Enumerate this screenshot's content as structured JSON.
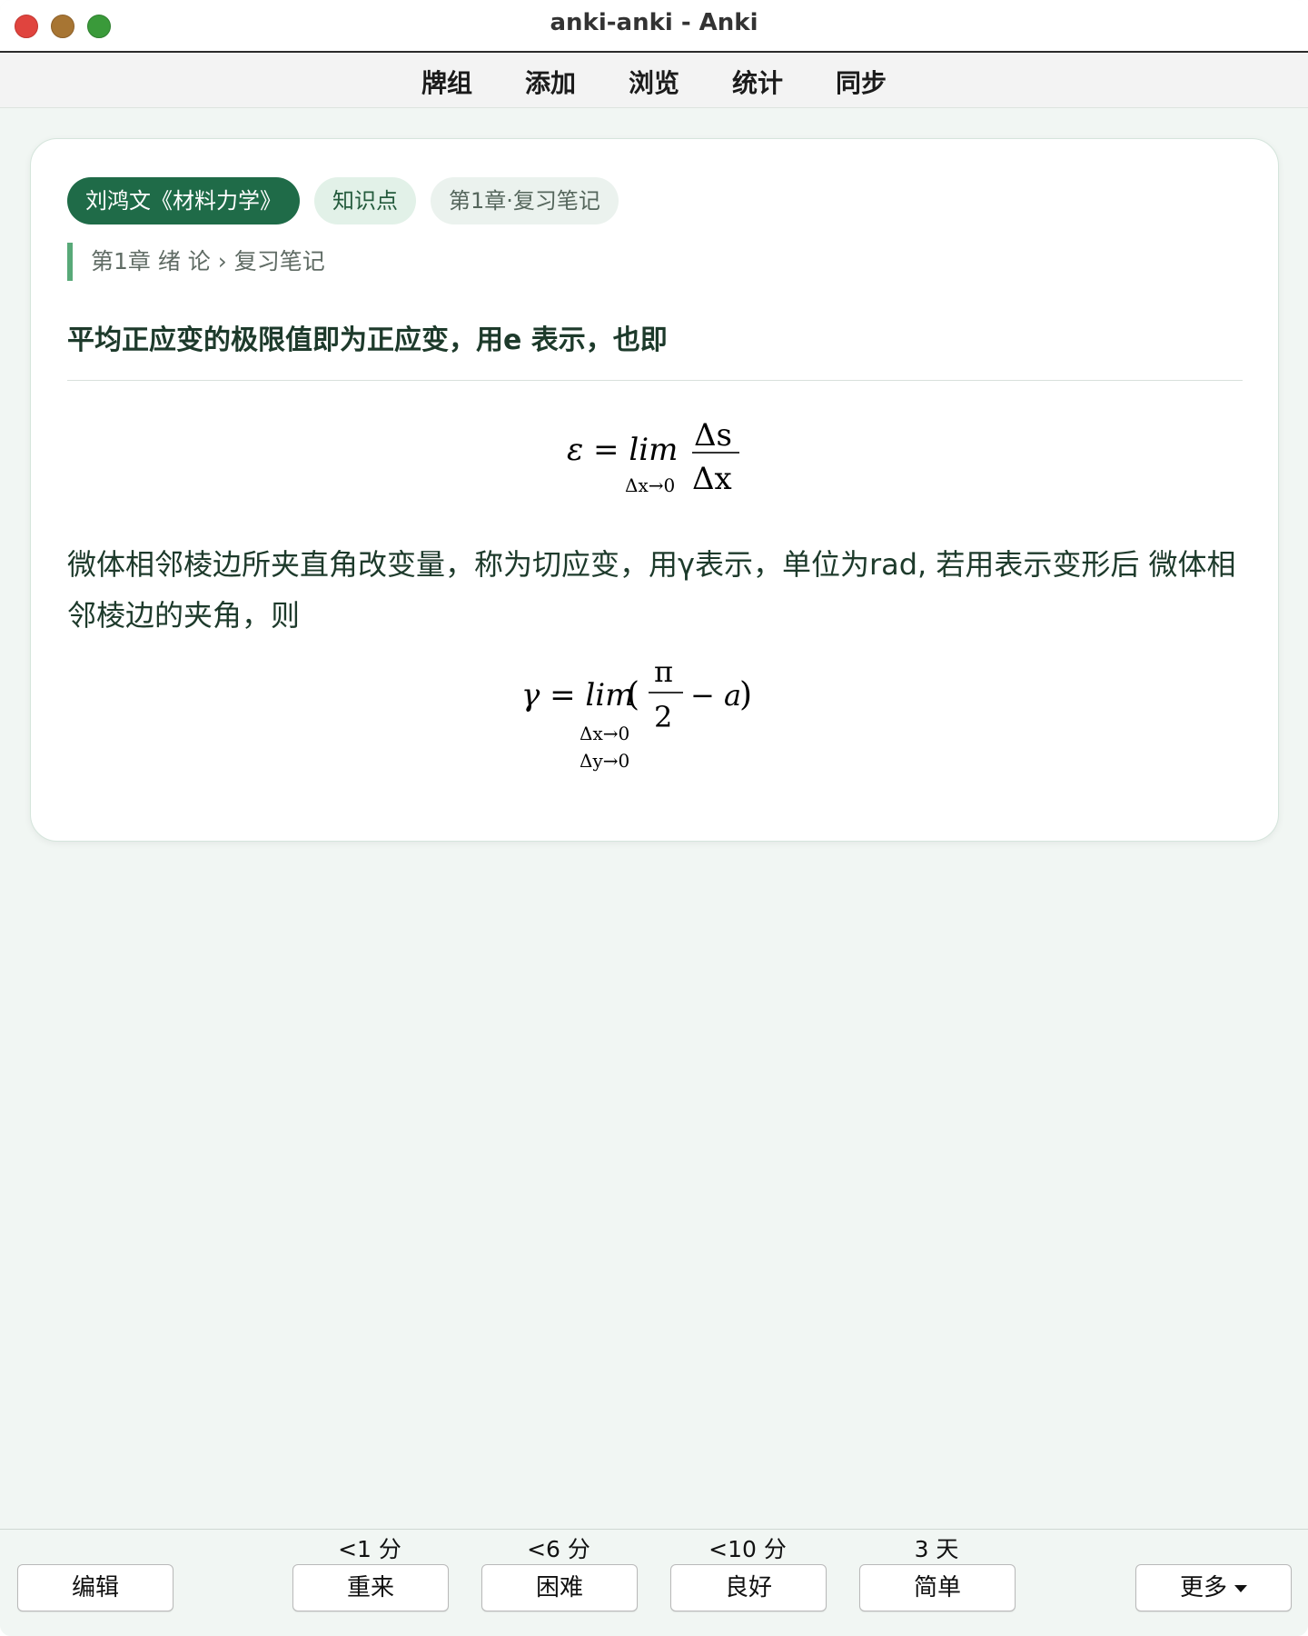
{
  "window": {
    "title": "anki-anki - Anki"
  },
  "toolbar": {
    "items": [
      "牌组",
      "添加",
      "浏览",
      "统计",
      "同步"
    ]
  },
  "card": {
    "tags": [
      "刘鸿文《材料力学》",
      "知识点",
      "第1章·复习笔记"
    ],
    "breadcrumb": "第1章 绪 论 › 复习笔记",
    "question": "平均正应变的极限值即为正应变，用e 表示，也即",
    "answer": "微体相邻棱边所夹直角改变量，称为切应变，用γ表示，单位为rad, 若用表示变形后 微体相邻棱边的夹角，则",
    "formula1": {
      "lhs": "ε = lim",
      "sub": "Δx→0",
      "numerator": "Δs",
      "denominator": "Δx"
    },
    "formula2": {
      "lhs": "γ = lim",
      "sub1": "Δx→0",
      "sub2": "Δy→0",
      "numerator": "π",
      "denominator": "2",
      "tail": "− a"
    }
  },
  "bottom": {
    "edit_label": "编辑",
    "answers": [
      {
        "interval": "<1 分",
        "label": "重来"
      },
      {
        "interval": "<6 分",
        "label": "困难"
      },
      {
        "interval": "<10 分",
        "label": "良好"
      },
      {
        "interval": "3 天",
        "label": "简单"
      }
    ],
    "more_label": "更多"
  }
}
